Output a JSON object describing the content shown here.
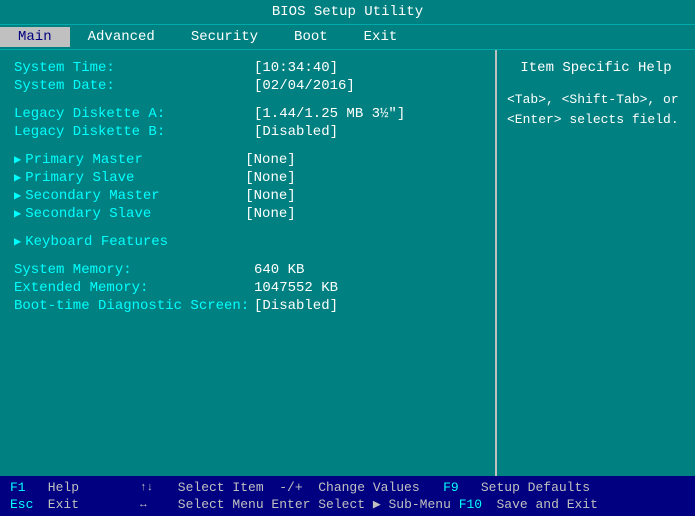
{
  "title": "BIOS Setup Utility",
  "menu": {
    "items": [
      {
        "label": "Main",
        "active": true
      },
      {
        "label": "Advanced",
        "active": false
      },
      {
        "label": "Security",
        "active": false
      },
      {
        "label": "Boot",
        "active": false
      },
      {
        "label": "Exit",
        "active": false
      }
    ]
  },
  "main": {
    "fields": [
      {
        "label": "System Time:",
        "value": "[10:34:40]",
        "highlight_char": "10"
      },
      {
        "label": "System Date:",
        "value": "[02/04/2016]"
      }
    ],
    "diskette": [
      {
        "label": "Legacy Diskette A:",
        "value": "[1.44/1.25 MB  3½\"]"
      },
      {
        "label": "Legacy Diskette B:",
        "value": "[Disabled]"
      }
    ],
    "submenus": [
      {
        "label": "Primary Master",
        "value": "[None]"
      },
      {
        "label": "Primary Slave",
        "value": "[None]"
      },
      {
        "label": "Secondary Master",
        "value": "[None]"
      },
      {
        "label": "Secondary Slave",
        "value": "[None]"
      }
    ],
    "keyboard": "Keyboard Features",
    "memory": [
      {
        "label": "System Memory:",
        "value": "640 KB"
      },
      {
        "label": "Extended Memory:",
        "value": "1047552 KB"
      },
      {
        "label": "Boot-time Diagnostic Screen:",
        "value": "[Disabled]"
      }
    ]
  },
  "help": {
    "title": "Item Specific Help",
    "text": "<Tab>, <Shift-Tab>, or <Enter> selects field."
  },
  "statusbar": {
    "row1": [
      {
        "key": "F1",
        "desc": "Help",
        "arrows": "↑↓",
        "arrow_desc": "Select Item",
        "sep": "-/+",
        "action": "Change Values",
        "fn": "F9",
        "fn_desc": "Setup Defaults"
      }
    ],
    "row2": [
      {
        "key": "Esc",
        "desc": "Exit",
        "arrows": "↔",
        "arrow_desc": "Select Menu",
        "sep": "Enter",
        "action": "Select ▶ Sub-Menu",
        "fn": "F10",
        "fn_desc": "Save and Exit"
      }
    ]
  }
}
